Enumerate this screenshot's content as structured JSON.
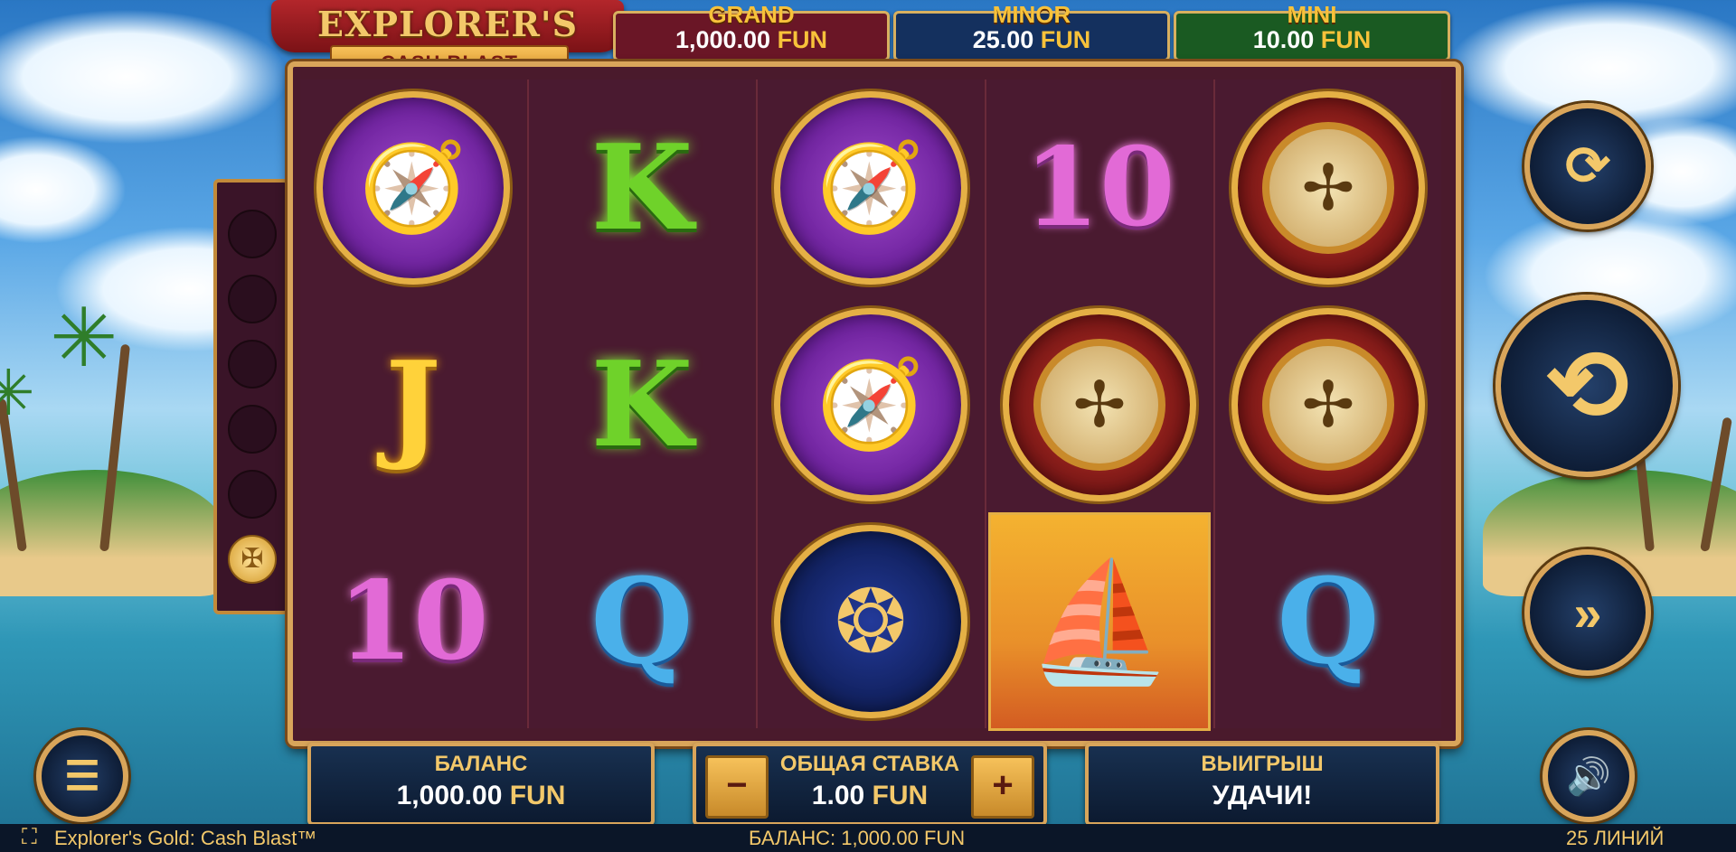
{
  "game": {
    "title": "EXPLORER'S GOLD",
    "subtitle": "CASH BLAST"
  },
  "jackpots": [
    {
      "label": "GRAND",
      "amount": "1,000.00",
      "currency": "FUN",
      "color": "#6a1626"
    },
    {
      "label": "MINOR",
      "amount": "25.00",
      "currency": "FUN",
      "color": "#14305e"
    },
    {
      "label": "MINI",
      "amount": "10.00",
      "currency": "FUN",
      "color": "#1a5a22"
    }
  ],
  "reels": [
    [
      "sextant-symbol",
      "J",
      "10"
    ],
    [
      "K",
      "K",
      "Q"
    ],
    [
      "sextant-symbol",
      "sextant-symbol",
      "necklace-symbol"
    ],
    [
      "10",
      "compass-symbol",
      "ship-symbol"
    ],
    [
      "compass-symbol",
      "compass-symbol",
      "Q"
    ]
  ],
  "collection": {
    "empty_slots": 5,
    "coin_icon": "gold-coin-icon"
  },
  "controls": {
    "autoplay_icon": "autoplay-icon",
    "spin_icon": "spin-icon",
    "turbo_icon": "fast-forward-icon",
    "menu_icon": "menu-icon",
    "sound_icon": "speaker-icon",
    "fullscreen_icon": "fullscreen-icon"
  },
  "panels": {
    "balance_label": "БАЛАНС",
    "balance_amount": "1,000.00",
    "balance_currency": "FUN",
    "bet_label": "ОБЩАЯ СТАВКА",
    "bet_amount": "1.00",
    "bet_currency": "FUN",
    "bet_minus": "−",
    "bet_plus": "+",
    "win_label": "ВЫИГРЫШ",
    "win_message": "УДАЧИ!"
  },
  "status_bar": {
    "game_name": "Explorer's Gold: Cash Blast™",
    "balance_text": "БАЛАНС: 1,000.00 FUN",
    "lines_text": "25 ЛИНИЙ"
  }
}
